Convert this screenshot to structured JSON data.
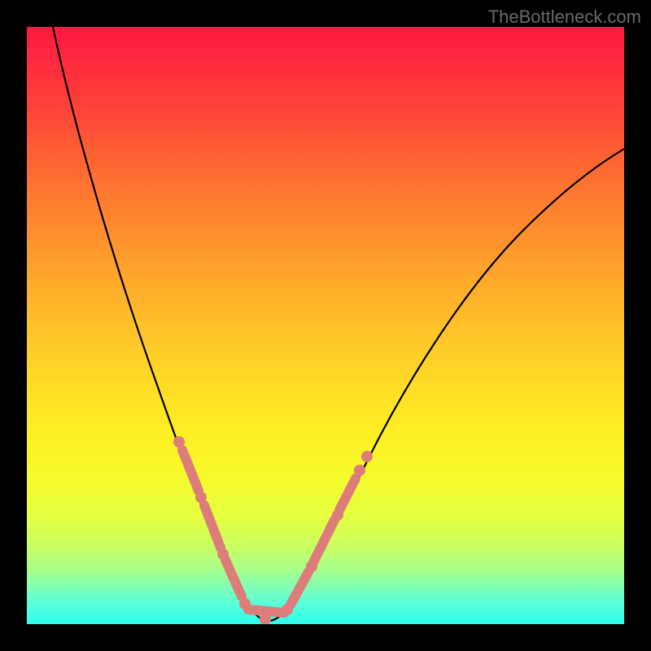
{
  "watermark": "TheBottleneck.com",
  "colors": {
    "background": "#000000",
    "watermark_text": "#6a6a6a",
    "curve": "#000000",
    "marker": "#dd7d79",
    "gradient_top": "#ff183f",
    "gradient_bottom": "#29ffee"
  },
  "chart_data": {
    "type": "line",
    "title": "",
    "xlabel": "",
    "ylabel": "",
    "xlim": [
      0,
      100
    ],
    "ylim": [
      0,
      100
    ],
    "x": [
      4,
      6,
      8,
      10,
      12,
      14,
      16,
      18,
      20,
      22,
      24,
      26,
      28,
      30,
      32,
      34,
      36,
      38,
      40,
      42,
      44,
      46,
      48,
      50,
      60,
      70,
      80,
      90,
      100
    ],
    "y": [
      100,
      93,
      86,
      79,
      73,
      66,
      60,
      53,
      47,
      41,
      35,
      29,
      24,
      18,
      13,
      8,
      4,
      1,
      0,
      1,
      4,
      8,
      15,
      22,
      38,
      48,
      56,
      62,
      67
    ],
    "highlighted_x_ranges": [
      [
        24,
        40
      ],
      [
        40,
        53
      ]
    ],
    "band_levels_pct": [
      72,
      95,
      99.5
    ]
  }
}
